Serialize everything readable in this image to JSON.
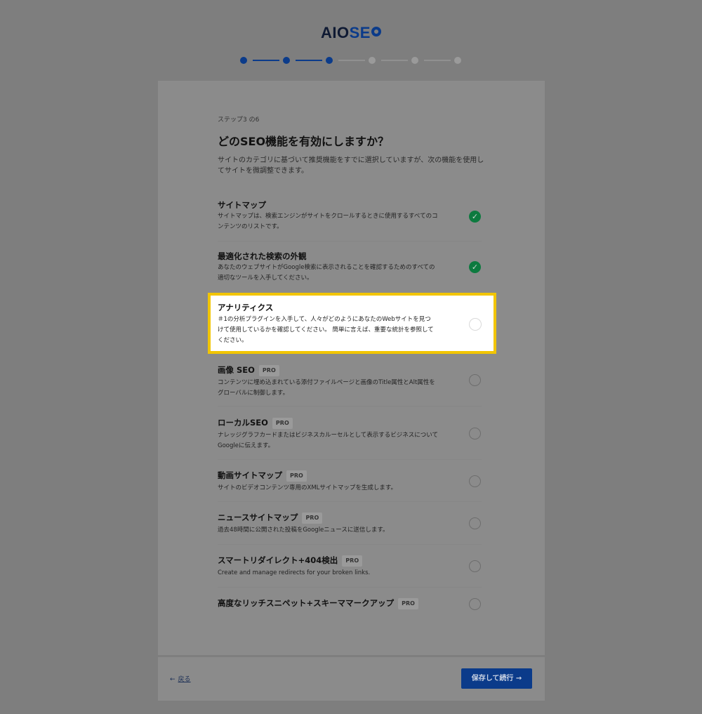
{
  "logo": {
    "part1": "AIO",
    "part2": "SE"
  },
  "progress": {
    "current_step": 3,
    "total_steps": 6
  },
  "step_label": "ステップ3 の6",
  "heading": "どのSEO機能を有効にしますか？",
  "intro": "サイトのカテゴリに基づいて推奨機能をすでに選択していますが、次の機能を使用してサイトを微調整できます。",
  "features": [
    {
      "name": "サイトマップ",
      "desc": "サイトマップは、検索エンジンがサイトをクロールするときに使用するすべてのコンテンツのリストです。",
      "checked": true
    },
    {
      "name": "最適化された検索の外観",
      "desc": "あなたのウェブサイトがGoogle検索に表示されることを確認するためのすべての適切なツールを入手してください。",
      "checked": true
    },
    {
      "name": "アナリティクス",
      "desc": "＃1の分析プラグインを入手して、人々がどのようにあなたのWebサイトを見つけて使用しているかを確認してください。 簡単に言えば、重要な統計を参照してください。",
      "checked": false,
      "highlighted": true
    },
    {
      "name": "画像 SEO",
      "pro": "PRO",
      "desc": "コンテンツに埋め込まれている添付ファイルページと画像のTitle属性とAlt属性をグローバルに制御します。",
      "checked": false
    },
    {
      "name": "ローカルSEO",
      "pro": "PRO",
      "desc": "ナレッジグラフカードまたはビジネスカルーセルとして表示するビジネスについてGoogleに伝えます。",
      "checked": false
    },
    {
      "name": "動画サイトマップ",
      "pro": "PRO",
      "desc": "サイトのビデオコンテンツ専用のXMLサイトマップを生成します。",
      "checked": false
    },
    {
      "name": "ニュースサイトマップ",
      "pro": "PRO",
      "desc": "過去48時間に公開された投稿をGoogleニュースに送信します。",
      "checked": false
    },
    {
      "name": "スマートリダイレクト+404検出",
      "pro": "PRO",
      "desc": "Create and manage redirects for your broken links.",
      "checked": false
    },
    {
      "name": "高度なリッチスニペット+スキーママークアップ",
      "pro": "PRO",
      "desc": "",
      "checked": false
    }
  ],
  "footer": {
    "back_arrow": "←",
    "back_label": "戻る",
    "save_label": "保存して続行 →"
  },
  "colors": {
    "brand": "#0b3b8a",
    "check": "#0d7a3f",
    "highlight_border": "#f2c500"
  }
}
